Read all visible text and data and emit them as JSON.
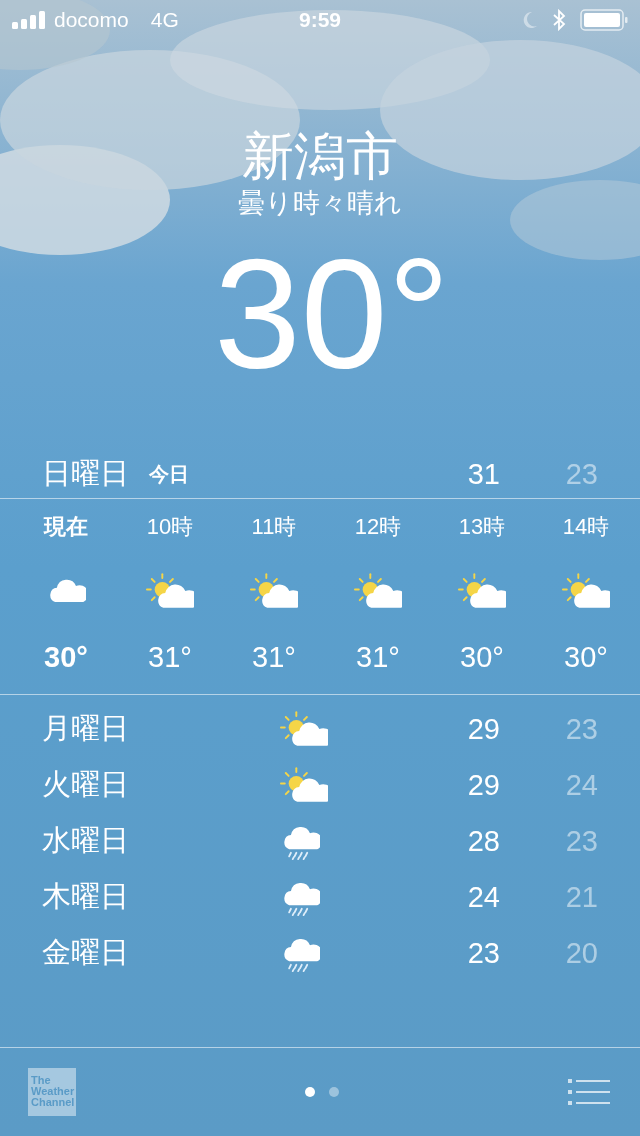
{
  "status_bar": {
    "carrier": "docomo",
    "network": "4G",
    "time": "9:59"
  },
  "location": {
    "city": "新潟市",
    "condition": "曇り時々晴れ",
    "temperature": "30°"
  },
  "today": {
    "day": "日曜日",
    "label": "今日",
    "high": "31",
    "low": "23"
  },
  "hourly": [
    {
      "time": "現在",
      "kind": "cloudy",
      "temp": "30°",
      "selected": true
    },
    {
      "time": "10時",
      "kind": "partly_sunny",
      "temp": "31°",
      "selected": false
    },
    {
      "time": "11時",
      "kind": "partly_sunny",
      "temp": "31°",
      "selected": false
    },
    {
      "time": "12時",
      "kind": "partly_sunny",
      "temp": "31°",
      "selected": false
    },
    {
      "time": "13時",
      "kind": "partly_sunny",
      "temp": "30°",
      "selected": false
    },
    {
      "time": "14時",
      "kind": "partly_sunny",
      "temp": "30°",
      "selected": false
    }
  ],
  "daily": [
    {
      "day": "月曜日",
      "kind": "partly_sunny",
      "high": "29",
      "low": "23"
    },
    {
      "day": "火曜日",
      "kind": "partly_sunny",
      "high": "29",
      "low": "24"
    },
    {
      "day": "水曜日",
      "kind": "rain",
      "high": "28",
      "low": "23"
    },
    {
      "day": "木曜日",
      "kind": "rain",
      "high": "24",
      "low": "21"
    },
    {
      "day": "金曜日",
      "kind": "rain",
      "high": "23",
      "low": "20"
    }
  ],
  "footer": {
    "logo": [
      "The",
      "Weather",
      "Channel"
    ],
    "pages": [
      {
        "selected": true
      },
      {
        "selected": false
      }
    ]
  }
}
